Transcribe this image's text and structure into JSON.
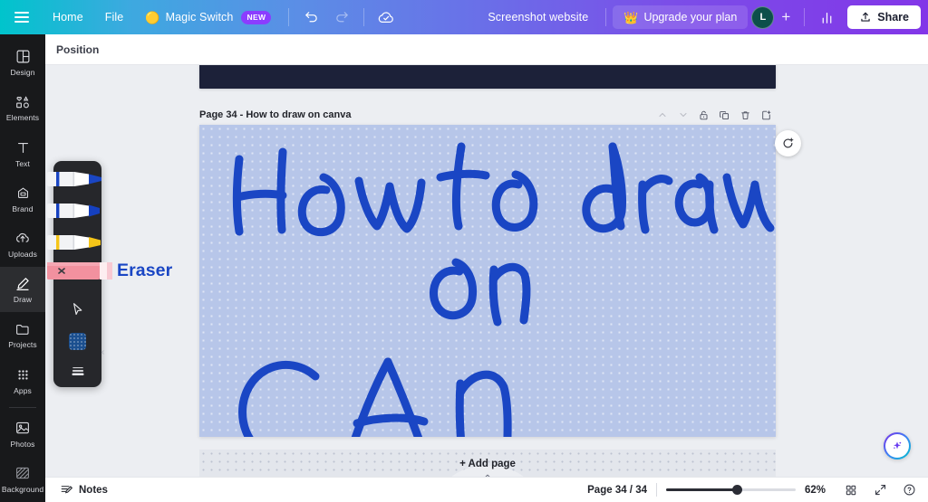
{
  "topbar": {
    "menu_icon": "hamburger-icon",
    "home_label": "Home",
    "file_label": "File",
    "magic_switch_label": "Magic Switch",
    "magic_switch_emoji": "🟡",
    "new_badge": "NEW",
    "undo_icon": "undo-icon",
    "redo_icon": "redo-icon",
    "cloud_saved_icon": "cloud-check-icon",
    "doc_title": "Screenshot website",
    "upgrade_label": "Upgrade your plan",
    "upgrade_crown": "👑",
    "avatar_initial": "L",
    "add_collaborator": "+",
    "insights_icon": "bar-chart-icon",
    "share_label": "Share",
    "share_icon": "upload-icon",
    "gradient_start": "#00c4cc",
    "gradient_end": "#8236e8"
  },
  "rail": {
    "items": [
      {
        "label": "Design",
        "icon": "design-icon",
        "active": false
      },
      {
        "label": "Elements",
        "icon": "elements-icon",
        "active": false
      },
      {
        "label": "Text",
        "icon": "text-icon",
        "active": false
      },
      {
        "label": "Brand",
        "icon": "brand-icon",
        "active": false
      },
      {
        "label": "Uploads",
        "icon": "uploads-icon",
        "active": false
      },
      {
        "label": "Draw",
        "icon": "draw-icon",
        "active": true
      },
      {
        "label": "Projects",
        "icon": "projects-icon",
        "active": false
      },
      {
        "label": "Apps",
        "icon": "apps-icon",
        "active": false
      },
      {
        "label": "Photos",
        "icon": "photos-icon",
        "active": false
      },
      {
        "label": "Background",
        "icon": "background-icon",
        "active": false
      }
    ]
  },
  "position_bar": {
    "label": "Position"
  },
  "page": {
    "title": "Page 34 - How to draw on canva",
    "tools": [
      {
        "name": "move-page-up-icon",
        "glyph": "⌃"
      },
      {
        "name": "move-page-down-icon",
        "glyph": "⌄"
      },
      {
        "name": "lock-page-icon",
        "glyph": "lock"
      },
      {
        "name": "duplicate-page-icon",
        "glyph": "duplicate"
      },
      {
        "name": "delete-page-icon",
        "glyph": "trash"
      },
      {
        "name": "add-page-icon",
        "glyph": "add-page"
      }
    ],
    "canvas_bg_color": "#b7c6e9",
    "ink_color": "#1a46c4",
    "handwriting_text": "How to draw on can",
    "refresh_icon": "refresh-animate-icon",
    "add_page_label": "+ Add page",
    "magic_fab_icon": "magic-sparkle-icon"
  },
  "draw_panel": {
    "tools": [
      {
        "name": "marker-blue-thin",
        "type": "pen",
        "color": "#1a46c4",
        "selected": false
      },
      {
        "name": "marker-blue-thick",
        "type": "pen",
        "color": "#1540c0",
        "selected": false
      },
      {
        "name": "highlighter-yellow",
        "type": "pen",
        "color": "#f5c518",
        "selected": false
      },
      {
        "name": "eraser",
        "type": "eraser",
        "color": "#f59ba8",
        "selected": true
      }
    ],
    "cursor_icon": "cursor-arrow-icon",
    "color_swatch": "#1b4f8f",
    "menu_icon": "stroke-width-icon",
    "collapse_icon": "chevron-left-icon",
    "callout_label": "Eraser",
    "callout_color": "#1a46c4"
  },
  "bottombar": {
    "notes_label": "Notes",
    "notes_icon": "notes-icon",
    "page_count": "Page 34 / 34",
    "zoom_percent": "62%",
    "grid_view_icon": "grid-view-icon",
    "fullscreen_icon": "fullscreen-icon",
    "help_icon": "help-icon"
  }
}
